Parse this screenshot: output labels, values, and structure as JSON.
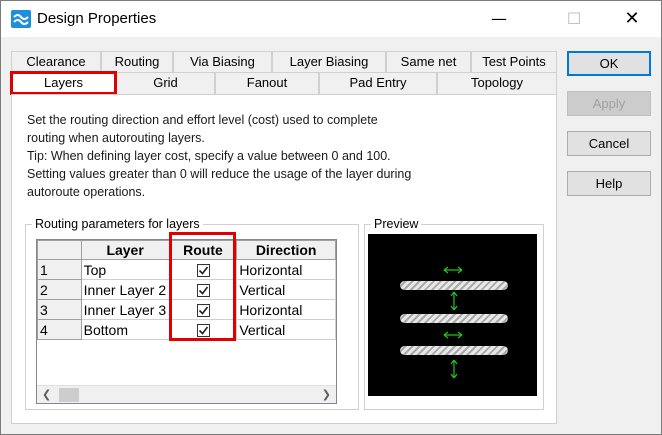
{
  "window": {
    "title": "Design Properties",
    "controls": {
      "minimize": "—",
      "maximize": "☐",
      "close": "✕"
    }
  },
  "tabs": {
    "back_row": [
      "Clearance",
      "Routing",
      "Via Biasing",
      "Layer Biasing",
      "Same net",
      "Test Points"
    ],
    "front_row": [
      "Layers",
      "Grid",
      "Fanout",
      "Pad Entry",
      "Topology"
    ],
    "active": "Layers"
  },
  "description": [
    "Set the routing direction and effort level (cost) used to complete",
    "routing when autorouting layers.",
    "Tip: When defining layer cost, specify a value between 0 and 100.",
    "Setting values greater than 0 will reduce the usage of the layer during",
    "autoroute operations."
  ],
  "routing_params": {
    "group_label": "Routing parameters for layers",
    "columns": [
      "",
      "Layer",
      "Route",
      "Direction"
    ],
    "rows": [
      {
        "num": "1",
        "layer": "Top",
        "route": true,
        "direction": "Horizontal"
      },
      {
        "num": "2",
        "layer": "Inner Layer 2",
        "route": true,
        "direction": "Vertical"
      },
      {
        "num": "3",
        "layer": "Inner Layer 3",
        "route": true,
        "direction": "Horizontal"
      },
      {
        "num": "4",
        "layer": "Bottom",
        "route": true,
        "direction": "Vertical"
      }
    ]
  },
  "preview": {
    "group_label": "Preview",
    "arrow_color": "#22c422"
  },
  "buttons": {
    "ok": "OK",
    "apply": "Apply",
    "cancel": "Cancel",
    "help": "Help"
  },
  "colors": {
    "highlight": "#e00000",
    "accent": "#0078d7"
  }
}
